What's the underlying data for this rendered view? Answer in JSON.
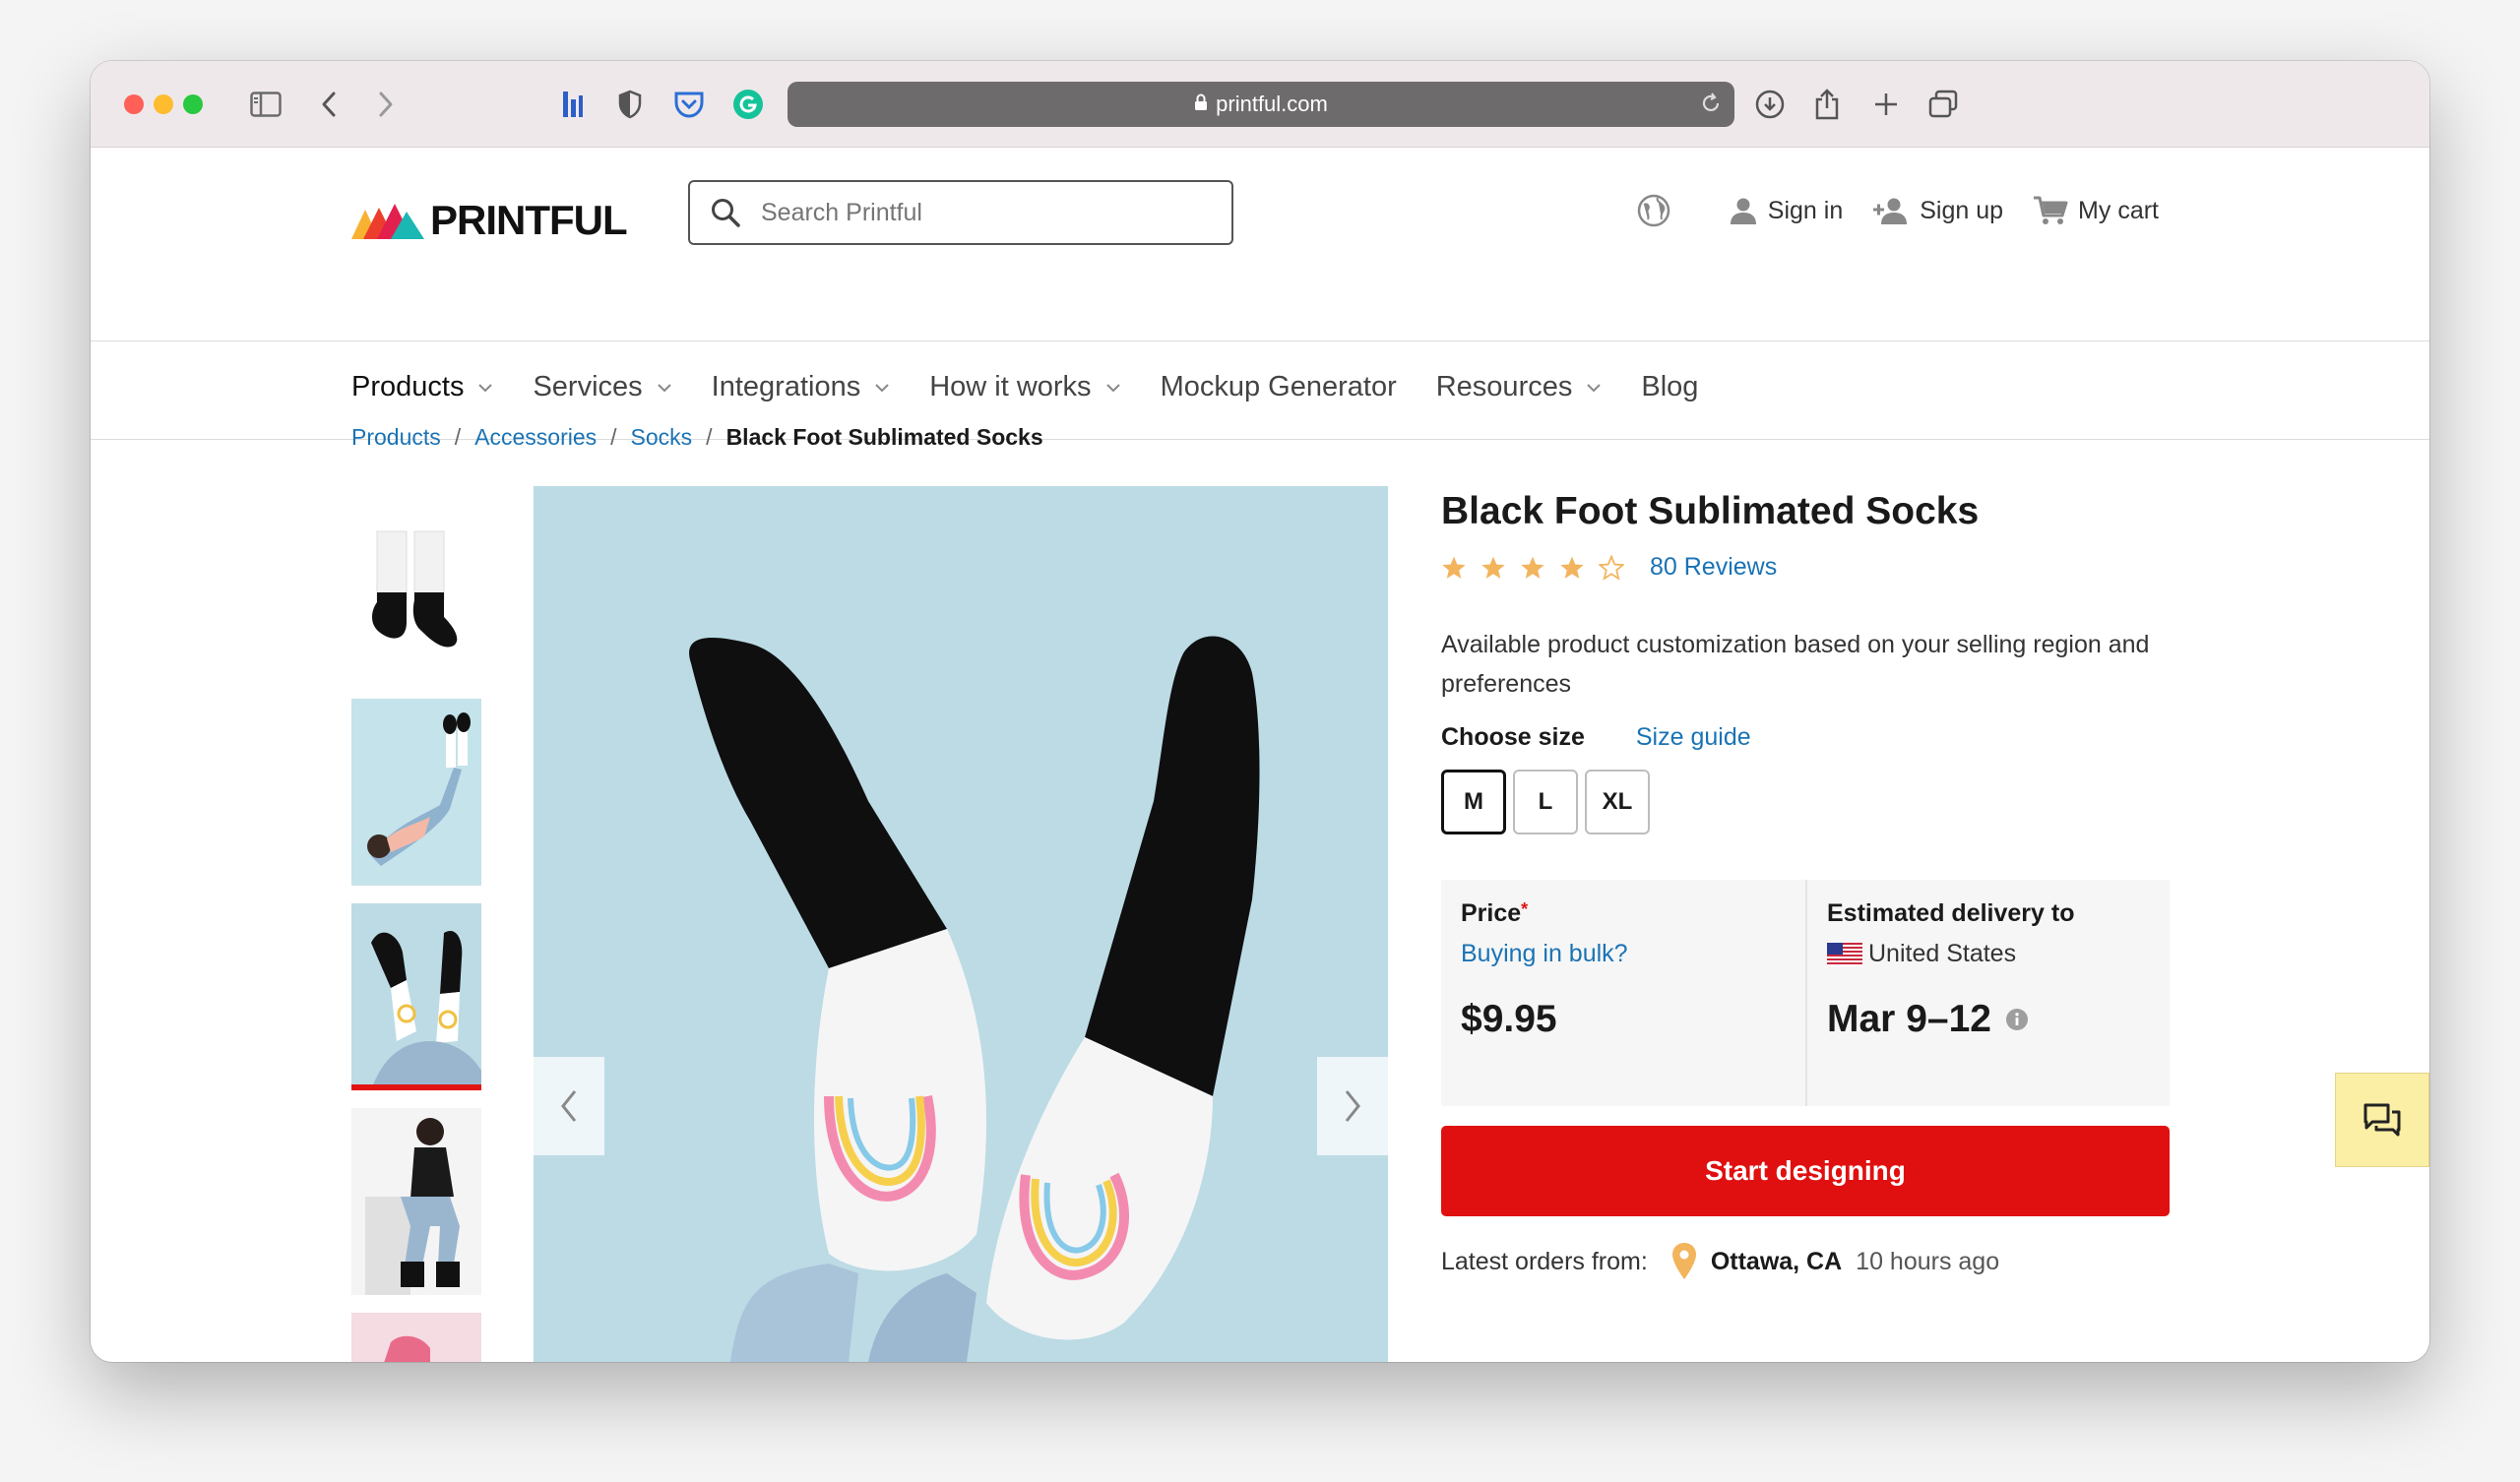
{
  "browser": {
    "url": "printful.com"
  },
  "header": {
    "logo_text": "PRINTFUL",
    "search_placeholder": "Search Printful",
    "sign_in": "Sign in",
    "sign_up": "Sign up",
    "cart": "My cart"
  },
  "nav": {
    "items": [
      {
        "label": "Products",
        "has_dropdown": true,
        "active": true
      },
      {
        "label": "Services",
        "has_dropdown": true
      },
      {
        "label": "Integrations",
        "has_dropdown": true
      },
      {
        "label": "How it works",
        "has_dropdown": true
      },
      {
        "label": "Mockup Generator",
        "has_dropdown": false
      },
      {
        "label": "Resources",
        "has_dropdown": true
      },
      {
        "label": "Blog",
        "has_dropdown": false
      }
    ]
  },
  "breadcrumb": {
    "items": [
      "Products",
      "Accessories",
      "Socks"
    ],
    "current": "Black Foot Sublimated Socks"
  },
  "gallery": {
    "selected_index": 2
  },
  "product": {
    "title": "Black Foot Sublimated Socks",
    "rating": 4,
    "rating_max": 5,
    "reviews": "80 Reviews",
    "description": "Available product customization based on your selling region and preferences",
    "size_label": "Choose size",
    "size_guide": "Size guide",
    "sizes": [
      "M",
      "L",
      "XL"
    ],
    "selected_size": "M",
    "price_label": "Price",
    "bulk_link": "Buying in bulk?",
    "price": "$9.95",
    "delivery_label": "Estimated delivery to",
    "country": "United States",
    "delivery_dates": "Mar 9–12",
    "cta": "Start designing",
    "latest_label": "Latest orders from:",
    "latest_city": "Ottawa, CA",
    "latest_time": "10 hours ago"
  },
  "colors": {
    "brand_red": "#e01010",
    "link_blue": "#1a73b5",
    "star": "#f2b45c",
    "chat_bg": "#fbeea5"
  }
}
